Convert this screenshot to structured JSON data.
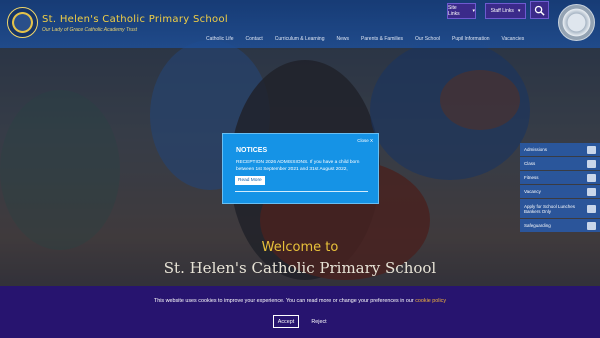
{
  "header": {
    "school_name": "St. Helen's Catholic Primary School",
    "tagline": "Our Lady of Grace Catholic Academy Trust",
    "quick_links": [
      {
        "label": "Site Links"
      },
      {
        "label": "Staff Links"
      }
    ],
    "nav": [
      "Catholic Life",
      "Contact",
      "Curriculum & Learning",
      "News",
      "Parents & Families",
      "Our School",
      "Pupil Information",
      "Vacancies"
    ]
  },
  "side_panel": {
    "items": [
      "Admissions",
      "Class",
      "Fitness",
      "Vacancy",
      "Apply for School Lunches Bankers Only",
      "Safeguarding"
    ]
  },
  "hero": {
    "welcome": "Welcome to",
    "school": "St. Helen's Catholic Primary School"
  },
  "notice": {
    "close": "Close X",
    "title": "NOTICES",
    "text": "RECEPTION 2026 ADMISSIONS. If you have a child born between 1st September 2021 and 31st August 2022,",
    "read_more": "Read More"
  },
  "cookie": {
    "text": "This website uses cookies to improve your experience. You can read more or change your preferences in our",
    "link": "cookie policy",
    "accept": "Accept",
    "reject": "Reject"
  },
  "colors": {
    "header": "#1e4e96",
    "gold": "#f2cf45",
    "notice": "#1593e6",
    "cookie_bar": "#27146f",
    "quick_link": "#3b2a8a"
  }
}
